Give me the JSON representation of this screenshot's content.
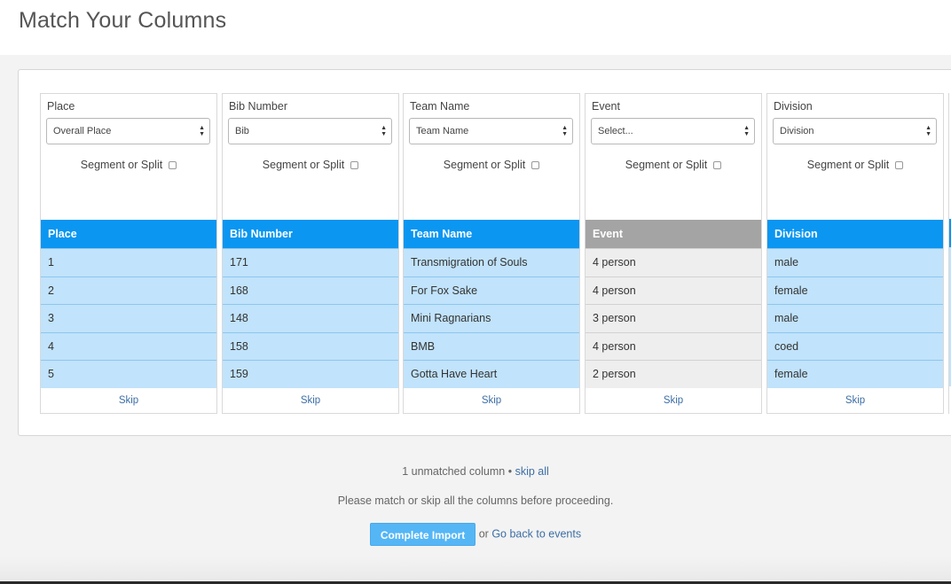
{
  "page": {
    "title": "Match Your Columns"
  },
  "columns": [
    {
      "header_label": "Place",
      "select_value": "Overall Place",
      "segment_label": "Segment or Split",
      "table_header": "Place",
      "values": [
        "1",
        "2",
        "3",
        "4",
        "5"
      ],
      "skip_label": "Skip",
      "matched": true
    },
    {
      "header_label": "Bib Number",
      "select_value": "Bib",
      "segment_label": "Segment or Split",
      "table_header": "Bib Number",
      "values": [
        "171",
        "168",
        "148",
        "158",
        "159"
      ],
      "skip_label": "Skip",
      "matched": true
    },
    {
      "header_label": "Team Name",
      "select_value": "Team Name",
      "segment_label": "Segment or Split",
      "table_header": "Team Name",
      "values": [
        "Transmigration of Souls",
        "For Fox Sake",
        "Mini Ragnarians",
        "BMB",
        "Gotta Have Heart"
      ],
      "skip_label": "Skip",
      "matched": true
    },
    {
      "header_label": "Event",
      "select_value": "Select...",
      "segment_label": "Segment or Split",
      "table_header": "Event",
      "values": [
        "4 person",
        "4 person",
        "3 person",
        "4 person",
        "2 person"
      ],
      "skip_label": "Skip",
      "matched": false
    },
    {
      "header_label": "Division",
      "select_value": "Division",
      "segment_label": "Segment or Split",
      "table_header": "Division",
      "values": [
        "male",
        "female",
        "male",
        "coed",
        "female"
      ],
      "skip_label": "Skip",
      "matched": true
    }
  ],
  "footer": {
    "unmatched_text": "1 unmatched column",
    "separator": "•",
    "skip_all_label": "skip all",
    "instruction": "Please match or skip all the columns before proceeding.",
    "complete_button": "Complete Import",
    "or_text": "or",
    "back_link": "Go back to events"
  },
  "colors": {
    "matched_header": "#0b96f1",
    "matched_cell": "#c1e3fb",
    "unmatched_header": "#a4a4a4",
    "unmatched_cell": "#eeeeee",
    "link": "#3d6ea5",
    "button": "#55b6f6"
  }
}
